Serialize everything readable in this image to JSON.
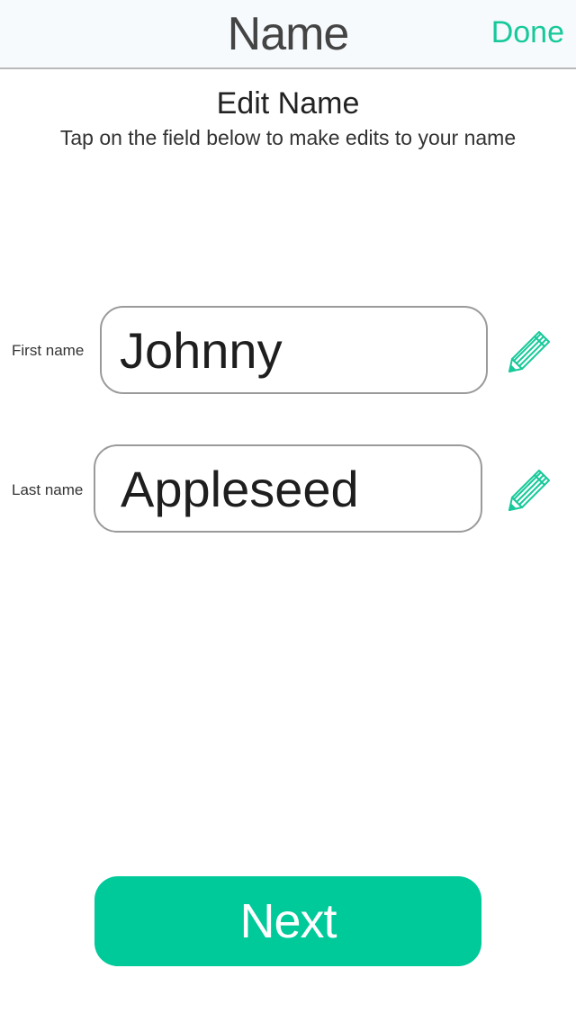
{
  "header": {
    "title": "Name",
    "done_label": "Done"
  },
  "intro": {
    "heading": "Edit Name",
    "subtitle": "Tap on the field below to make edits to your name"
  },
  "form": {
    "first_name": {
      "label": "First name",
      "value": "Johnny",
      "icon": "pencil-icon"
    },
    "last_name": {
      "label": "Last name",
      "value": "Appleseed",
      "icon": "pencil-icon"
    }
  },
  "actions": {
    "next_label": "Next"
  },
  "colors": {
    "accent": "#00c99a",
    "done_text": "#17c99a",
    "field_border": "#9a9a9a",
    "nav_background": "#f7fafd"
  }
}
